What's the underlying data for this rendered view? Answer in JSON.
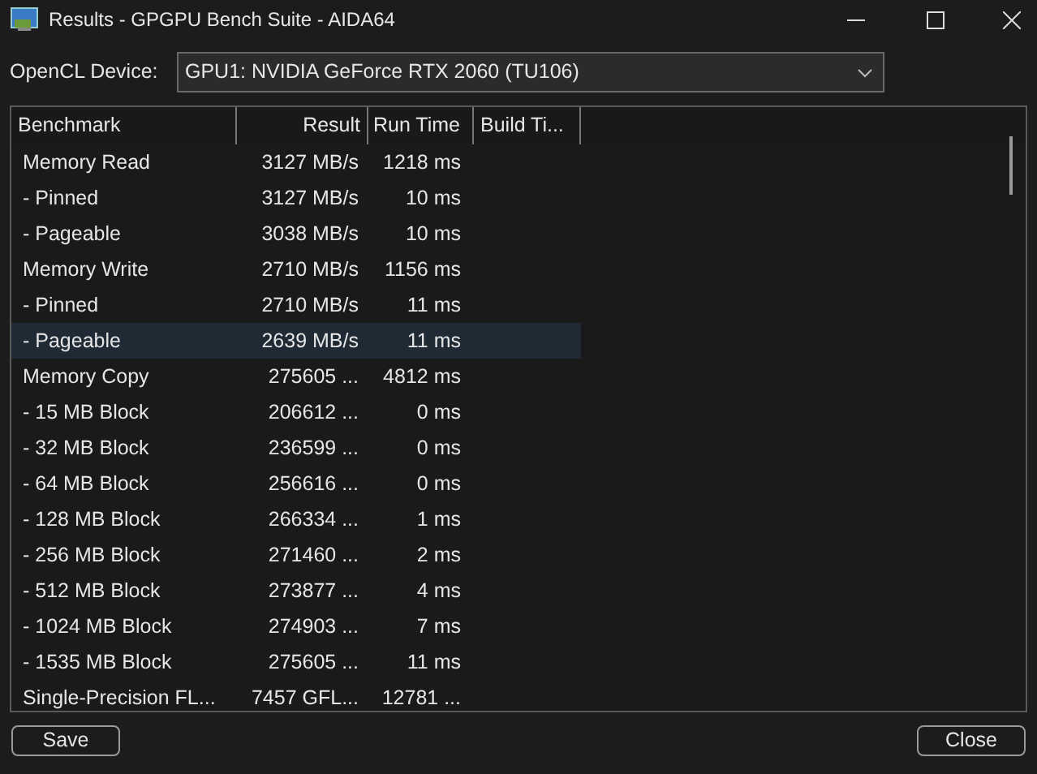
{
  "window": {
    "title": "Results - GPGPU Bench Suite - AIDA64"
  },
  "device": {
    "label": "OpenCL Device:",
    "value": "GPU1: NVIDIA GeForce RTX 2060 (TU106)"
  },
  "table": {
    "columns": [
      "Benchmark",
      "Result",
      "Run Time",
      "Build Ti..."
    ],
    "rows": [
      {
        "cells": [
          "Memory Read",
          "3127 MB/s",
          "1218 ms"
        ],
        "selected": false
      },
      {
        "cells": [
          "- Pinned",
          "3127 MB/s",
          "10 ms"
        ],
        "selected": false
      },
      {
        "cells": [
          "- Pageable",
          "3038 MB/s",
          "10 ms"
        ],
        "selected": false
      },
      {
        "cells": [
          "Memory Write",
          "2710 MB/s",
          "1156 ms"
        ],
        "selected": false
      },
      {
        "cells": [
          "- Pinned",
          "2710 MB/s",
          "11 ms"
        ],
        "selected": false
      },
      {
        "cells": [
          "- Pageable",
          "2639 MB/s",
          "11 ms"
        ],
        "selected": true
      },
      {
        "cells": [
          "Memory Copy",
          "275605 ...",
          "4812 ms"
        ],
        "selected": false
      },
      {
        "cells": [
          "- 15 MB Block",
          "206612 ...",
          "0 ms"
        ],
        "selected": false
      },
      {
        "cells": [
          "- 32 MB Block",
          "236599 ...",
          "0 ms"
        ],
        "selected": false
      },
      {
        "cells": [
          "- 64 MB Block",
          "256616 ...",
          "0 ms"
        ],
        "selected": false
      },
      {
        "cells": [
          "- 128 MB Block",
          "266334 ...",
          "1 ms"
        ],
        "selected": false
      },
      {
        "cells": [
          "- 256 MB Block",
          "271460 ...",
          "2 ms"
        ],
        "selected": false
      },
      {
        "cells": [
          "- 512 MB Block",
          "273877 ...",
          "4 ms"
        ],
        "selected": false
      },
      {
        "cells": [
          "- 1024 MB Block",
          "274903 ...",
          "7 ms"
        ],
        "selected": false
      },
      {
        "cells": [
          "- 1535 MB Block",
          "275605 ...",
          "11 ms"
        ],
        "selected": false
      },
      {
        "cells": [
          "Single-Precision FL...",
          "7457 GFL...",
          "12781 ..."
        ],
        "selected": false
      }
    ]
  },
  "buttons": [
    {
      "label": "Save"
    },
    {
      "label": "Close"
    }
  ]
}
